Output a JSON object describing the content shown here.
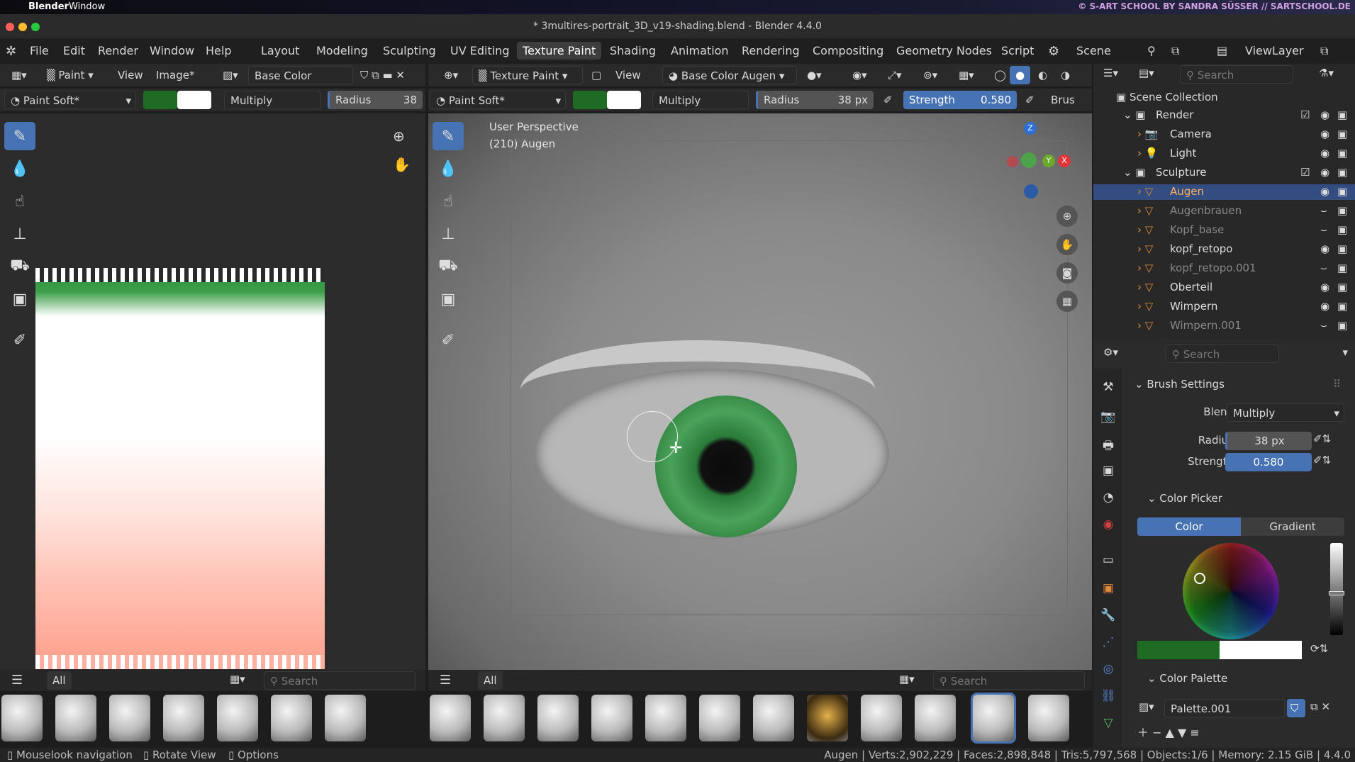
{
  "macbar": {
    "app": "Blender",
    "window": "Window",
    "watermark": "© S-ART SCHOOL BY SANDRA SÜSSER // SARTSCHOOL.DE"
  },
  "title": "* 3multires-portrait_3D_v19-shading.blend - Blender 4.4.0",
  "menu": [
    "File",
    "Edit",
    "Render",
    "Window",
    "Help"
  ],
  "workspaces": [
    "Layout",
    "Modeling",
    "Sculpting",
    "UV Editing",
    "Texture Paint",
    "Shading",
    "Animation",
    "Rendering",
    "Compositing",
    "Geometry Nodes",
    "Script"
  ],
  "active_workspace": "Texture Paint",
  "scene": "Scene",
  "viewlayer": "ViewLayer",
  "image_editor": {
    "mode": "Paint",
    "view": "View",
    "image": "Image*",
    "texture": "Base Color Augen",
    "brush": "Paint Soft*",
    "blend": "Multiply",
    "radius_label": "Radius",
    "radius_value": "38",
    "filter": "All",
    "search": "Search"
  },
  "viewport": {
    "mode": "Texture Paint",
    "view": "View",
    "texture": "Base Color Augen",
    "brush": "Paint Soft*",
    "blend": "Multiply",
    "radius_label": "Radius",
    "radius_value": "38 px",
    "strength_label": "Strength",
    "strength_value": "0.580",
    "brush_cut": "Brus",
    "perspective": "User Perspective",
    "object_info": "(210) Augen",
    "filter": "All",
    "search": "Search",
    "axes": {
      "z": "Z",
      "y": "Y",
      "x": "X"
    }
  },
  "outliner": {
    "search": "Search",
    "scene_collection": "Scene Collection",
    "items": [
      {
        "name": "Render",
        "level": 0,
        "type": "collection"
      },
      {
        "name": "Camera",
        "level": 1,
        "type": "camera"
      },
      {
        "name": "Light",
        "level": 1,
        "type": "light"
      },
      {
        "name": "Sculpture",
        "level": 0,
        "type": "collection"
      },
      {
        "name": "Augen",
        "level": 1,
        "type": "mesh",
        "active": true
      },
      {
        "name": "Augenbrauen",
        "level": 1,
        "type": "mesh",
        "dim": true
      },
      {
        "name": "Kopf_base",
        "level": 1,
        "type": "mesh",
        "dim": true
      },
      {
        "name": "kopf_retopo",
        "level": 1,
        "type": "mesh"
      },
      {
        "name": "kopf_retopo.001",
        "level": 1,
        "type": "mesh",
        "dim": true
      },
      {
        "name": "Oberteil",
        "level": 1,
        "type": "mesh"
      },
      {
        "name": "Wimpern",
        "level": 1,
        "type": "mesh"
      },
      {
        "name": "Wimpern.001",
        "level": 1,
        "type": "mesh",
        "dim": true
      }
    ]
  },
  "properties": {
    "search": "Search",
    "brush_settings": "Brush Settings",
    "blend_label": "Blend",
    "blend_value": "Multiply",
    "radius_label": "Radius",
    "radius_value": "38 px",
    "strength_label": "Strength",
    "strength_value": "0.580",
    "color_picker": "Color Picker",
    "tab_color": "Color",
    "tab_gradient": "Gradient",
    "color_palette": "Color Palette",
    "palette_name": "Palette.001"
  },
  "colors": {
    "accent": "#4772b3",
    "primary_color": "#1e6b24",
    "secondary_color": "#ffffff"
  },
  "status": {
    "left1": "Mouselook navigation",
    "left2": "Rotate View",
    "left3": "Options",
    "stats": "Augen | Verts:2,902,229 | Faces:2,898,848 | Tris:5,797,568 | Objects:1/6 | Memory: 2.15 GiB | 4.4.0"
  }
}
